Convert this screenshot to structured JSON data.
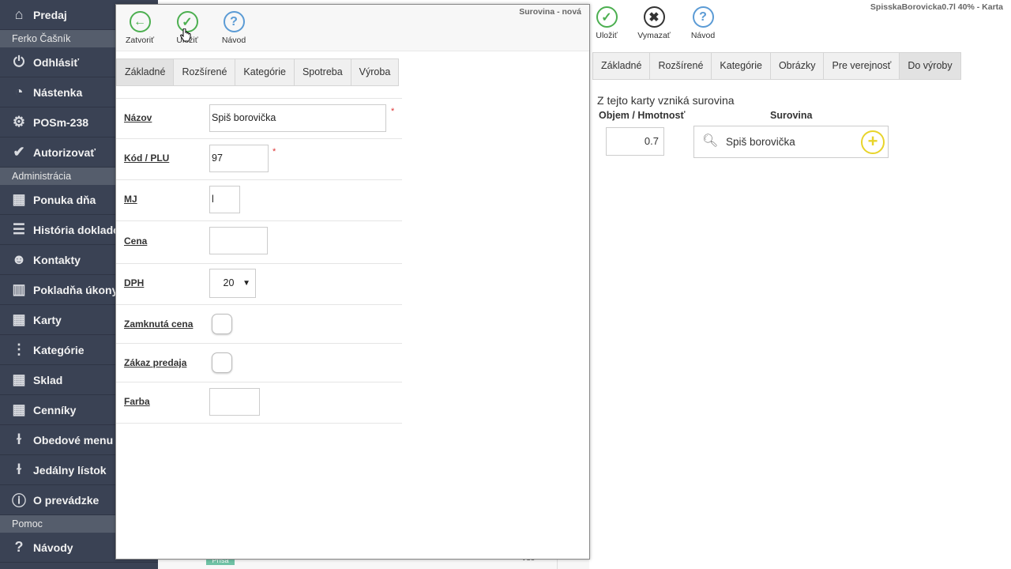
{
  "sidebar": {
    "items": [
      {
        "label": "Predaj",
        "icon": "home-icon"
      },
      {
        "section": "Ferko Čašník"
      },
      {
        "label": "Odhlásiť",
        "icon": "power-icon"
      },
      {
        "label": "Nástenka",
        "icon": "dashboard-icon"
      },
      {
        "label": "POSm-238",
        "icon": "gear-icon"
      },
      {
        "label": "Autorizovať",
        "icon": "check-circle-icon"
      },
      {
        "section": "Administrácia"
      },
      {
        "label": "Ponuka dňa",
        "icon": "star-boxes-icon"
      },
      {
        "label": "História dokladov",
        "icon": "list-icon"
      },
      {
        "label": "Kontakty",
        "icon": "users-icon"
      },
      {
        "label": "Pokladňa úkony",
        "icon": "bar-chart-icon"
      },
      {
        "label": "Karty",
        "icon": "boxes-icon"
      },
      {
        "label": "Kategórie",
        "icon": "tree-icon"
      },
      {
        "label": "Sklad",
        "icon": "boxes-icon"
      },
      {
        "label": "Cenníky",
        "icon": "boxes-icon"
      },
      {
        "label": "Obedové menu",
        "icon": "cutlery-icon"
      },
      {
        "label": "Jedálny lístok",
        "icon": "cutlery-icon"
      },
      {
        "label": "O prevádzke",
        "icon": "info-icon"
      },
      {
        "section": "Pomoc"
      },
      {
        "label": "Návody",
        "icon": "help-icon"
      }
    ]
  },
  "background_page": {
    "title": "SpisskaBorovicka0.7l 40% - Karta",
    "toolbar": {
      "save": "Uložiť",
      "delete": "Vymazať",
      "help": "Návod"
    },
    "tabs": [
      "Základné",
      "Rozšírené",
      "Kategórie",
      "Obrázky",
      "Pre verejnosť",
      "Do výroby"
    ],
    "active_tab": "Do výroby",
    "note": "Z tejto karty vzniká surovina",
    "col_volume": "Objem / Hmotnosť",
    "col_material": "Surovina",
    "volume_value": "0.7",
    "material_value": "Spiš borovička",
    "bottom_badge": "Prísa",
    "bottom_right": "Vše"
  },
  "modal": {
    "title": "Surovina - nová",
    "toolbar": {
      "close": "Zatvoriť",
      "save": "Uložiť",
      "help": "Návod"
    },
    "tabs": [
      "Základné",
      "Rozšírené",
      "Kategórie",
      "Spotreba",
      "Výroba"
    ],
    "active_tab": "Základné",
    "fields": {
      "name_label": "Názov",
      "name_value": "Spiš borovička",
      "code_label": "Kód / PLU",
      "code_value": "97",
      "unit_label": "MJ",
      "unit_value": "l",
      "price_label": "Cena",
      "price_value": "",
      "vat_label": "DPH",
      "vat_value": "20",
      "locked_price_label": "Zamknutá cena",
      "sale_ban_label": "Zákaz predaja",
      "color_label": "Farba"
    },
    "required_mark": "*"
  },
  "colors": {
    "sidebar_bg": "#3a4254",
    "section_bg": "#555d6c",
    "green": "#4caf50",
    "blue": "#5b9bd5",
    "yellow": "#e8d42b"
  }
}
